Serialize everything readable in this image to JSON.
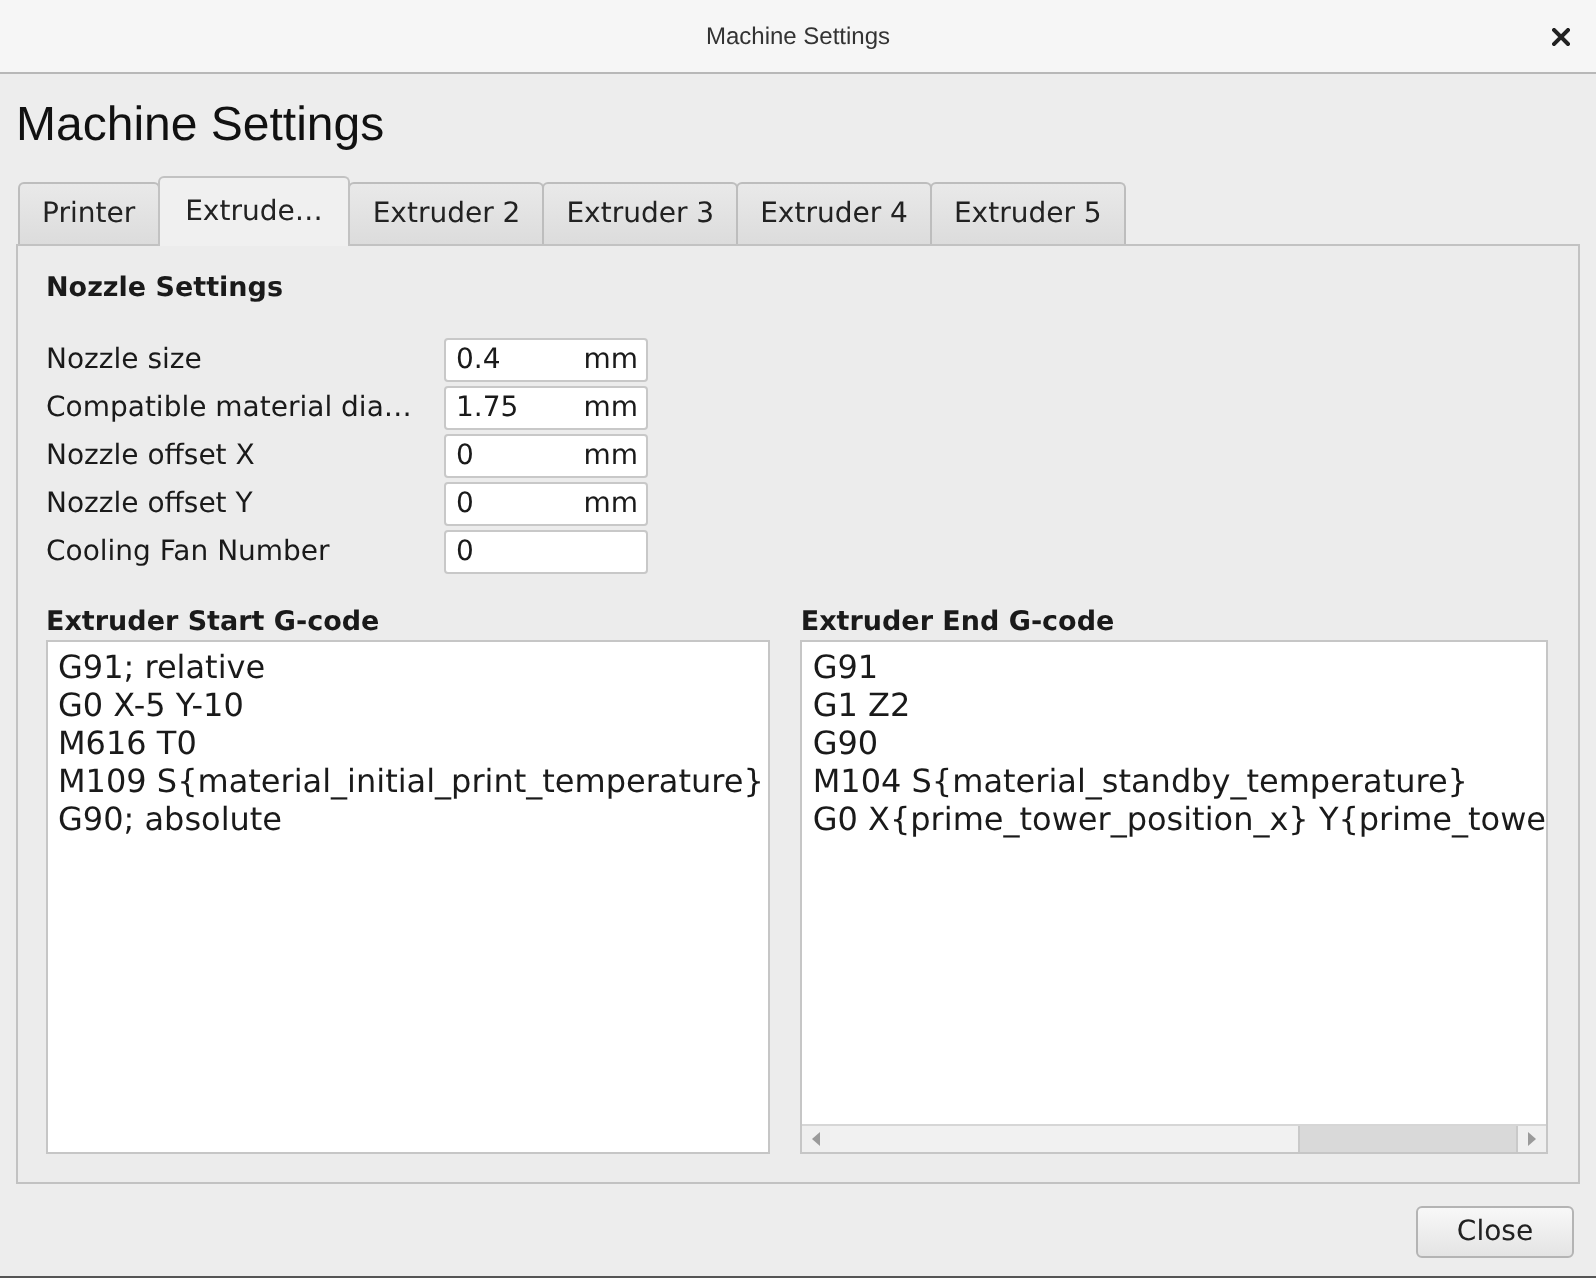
{
  "window": {
    "title": "Machine Settings"
  },
  "heading": "Machine Settings",
  "tabs": [
    {
      "label": "Printer",
      "selected": false
    },
    {
      "label": "Extrude…",
      "selected": true
    },
    {
      "label": "Extruder 2",
      "selected": false
    },
    {
      "label": "Extruder 3",
      "selected": false
    },
    {
      "label": "Extruder 4",
      "selected": false
    },
    {
      "label": "Extruder 5",
      "selected": false
    }
  ],
  "nozzle_settings": {
    "title": "Nozzle Settings",
    "fields": [
      {
        "label": "Nozzle size",
        "value": "0.4",
        "unit": "mm"
      },
      {
        "label": "Compatible material dia…",
        "value": "1.75",
        "unit": "mm"
      },
      {
        "label": "Nozzle offset X",
        "value": "0",
        "unit": "mm"
      },
      {
        "label": "Nozzle offset Y",
        "value": "0",
        "unit": "mm"
      },
      {
        "label": "Cooling Fan Number",
        "value": "0"
      }
    ]
  },
  "gcode_editors": [
    {
      "title": "Extruder Start G-code",
      "lines": [
        "G91; relative",
        "G0 X-5 Y-10",
        "M616 T0",
        "M109 S{material_initial_print_temperature}",
        "G90; absolute"
      ],
      "horizontal_scrollbar": false
    },
    {
      "title": "Extruder End G-code",
      "lines": [
        "G91",
        "G1 Z2",
        "G90",
        "M104 S{material_standby_temperature}",
        "G0 X{prime_tower_position_x} Y{prime_towe"
      ],
      "horizontal_scrollbar": true
    }
  ],
  "buttons": [
    {
      "label": "Close"
    }
  ]
}
